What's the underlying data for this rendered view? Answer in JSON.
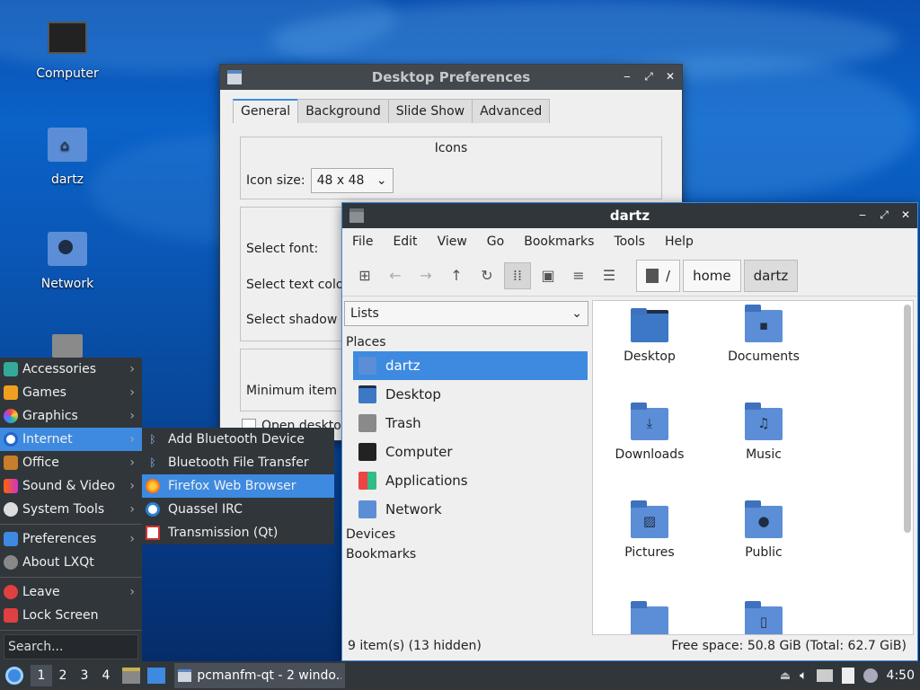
{
  "desktop": {
    "icons": [
      {
        "label": "Computer",
        "icon": "computer-icon"
      },
      {
        "label": "dartz",
        "icon": "home-folder-icon"
      },
      {
        "label": "Network",
        "icon": "network-folder-icon"
      },
      {
        "label": "",
        "icon": "trash-icon"
      }
    ]
  },
  "desktop_prefs": {
    "title": "Desktop Preferences",
    "tabs": [
      "General",
      "Background",
      "Slide Show",
      "Advanced"
    ],
    "icons_group": "Icons",
    "icon_size_label": "Icon size:",
    "icon_size_value": "48 x 48",
    "select_font": "Select font:",
    "select_text_color": "Select text colo",
    "select_shadow": "Select shadow c",
    "min_item": "Minimum item r",
    "open_desktop": "Open desktop"
  },
  "fm": {
    "title": "dartz",
    "menu": [
      "File",
      "Edit",
      "View",
      "Go",
      "Bookmarks",
      "Tools",
      "Help"
    ],
    "breadcrumb": [
      "/",
      "home",
      "dartz"
    ],
    "side_combo": "Lists",
    "places_header": "Places",
    "places": [
      {
        "label": "dartz",
        "icon": "home-folder-icon"
      },
      {
        "label": "Desktop",
        "icon": "desktop-icon"
      },
      {
        "label": "Trash",
        "icon": "trash-icon"
      },
      {
        "label": "Computer",
        "icon": "computer-icon"
      },
      {
        "label": "Applications",
        "icon": "applications-icon"
      },
      {
        "label": "Network",
        "icon": "network-icon"
      }
    ],
    "devices": "Devices",
    "bookmarks": "Bookmarks",
    "files": [
      {
        "label": "Desktop",
        "icon": "desktop-icon"
      },
      {
        "label": "Documents",
        "icon": "documents-folder-icon"
      },
      {
        "label": "Downloads",
        "icon": "downloads-folder-icon"
      },
      {
        "label": "Music",
        "icon": "music-folder-icon"
      },
      {
        "label": "Pictures",
        "icon": "pictures-folder-icon"
      },
      {
        "label": "Public",
        "icon": "public-folder-icon"
      },
      {
        "label": "",
        "icon": "folder-icon"
      },
      {
        "label": "",
        "icon": "templates-folder-icon"
      }
    ],
    "status_left": "9 item(s) (13 hidden)",
    "status_right": "Free space: 50.8 GiB (Total: 62.7 GiB)"
  },
  "start_menu": {
    "items": [
      {
        "label": "Accessories",
        "sub": true
      },
      {
        "label": "Games",
        "sub": true
      },
      {
        "label": "Graphics",
        "sub": true
      },
      {
        "label": "Internet",
        "sub": true
      },
      {
        "label": "Office",
        "sub": true
      },
      {
        "label": "Sound & Video",
        "sub": true
      },
      {
        "label": "System Tools",
        "sub": true
      },
      {
        "label": "Preferences",
        "sub": true
      },
      {
        "label": "About LXQt",
        "sub": false
      },
      {
        "label": "Leave",
        "sub": true
      },
      {
        "label": "Lock Screen",
        "sub": false
      }
    ],
    "search_placeholder": "Search..."
  },
  "internet_submenu": [
    "Add Bluetooth Device",
    "Bluetooth File Transfer",
    "Firefox Web Browser",
    "Quassel IRC",
    "Transmission (Qt)"
  ],
  "taskbar": {
    "workspaces": [
      "1",
      "2",
      "3",
      "4"
    ],
    "task": "pcmanfm-qt - 2 windo...",
    "clock": "4:50"
  },
  "colors": {
    "accent": "#3d8ae0",
    "panel": "#31363b",
    "folder": "#5b8ed6"
  }
}
